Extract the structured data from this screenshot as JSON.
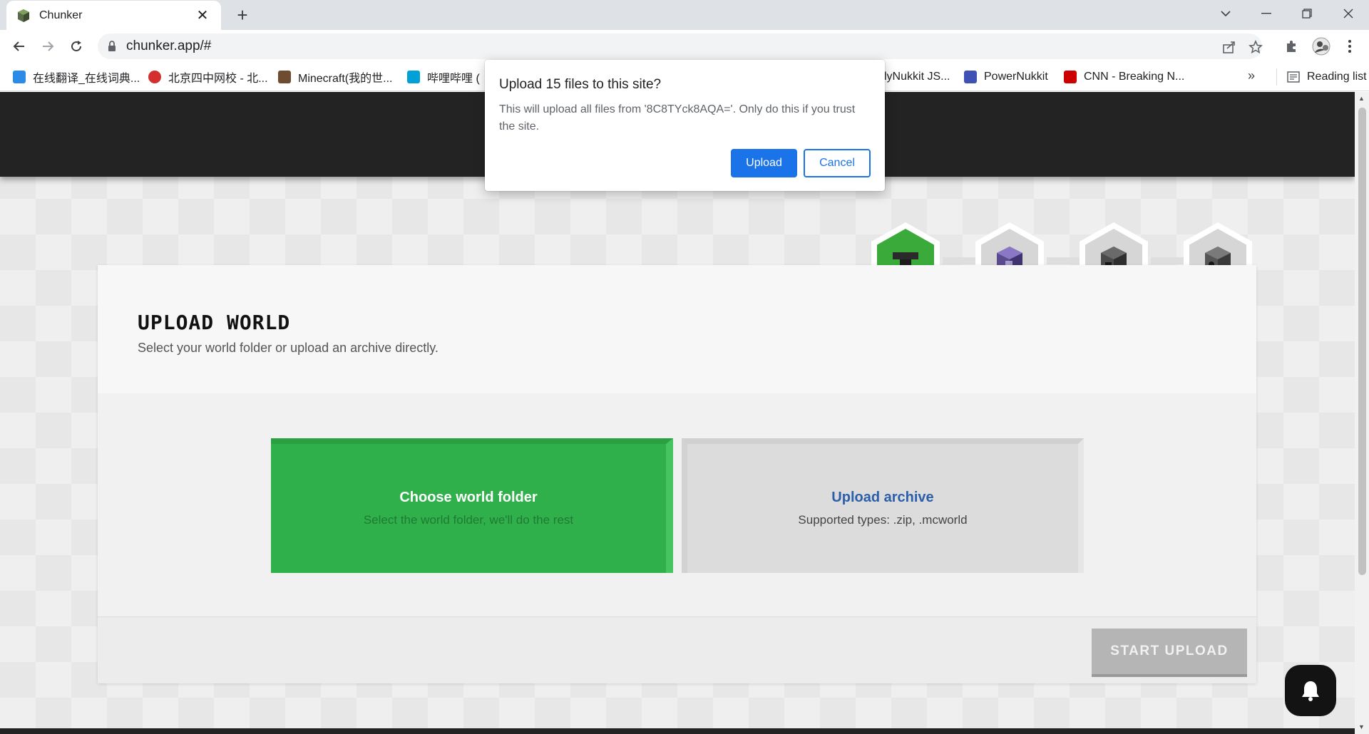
{
  "tab": {
    "title": "Chunker"
  },
  "toolbar": {
    "url": "chunker.app/#"
  },
  "bookmarks": [
    {
      "label": "在线翻译_在线词典...",
      "icon": "translate-icon",
      "color": "#2b8be6"
    },
    {
      "label": "北京四中网校 - 北...",
      "icon": "school-icon",
      "color": "#d32f2f"
    },
    {
      "label": "Minecraft(我的世...",
      "icon": "minecraft-icon",
      "color": "#6d4c2f"
    },
    {
      "label": "哔哩哔哩 (",
      "icon": "bilibili-icon",
      "color": "#00a1d6"
    },
    {
      "label": "lyNukkit JS...",
      "icon": "nukkit-icon",
      "color": "#4a4a4a"
    },
    {
      "label": "PowerNukkit",
      "icon": "powernukkit-icon",
      "color": "#3f51b5"
    },
    {
      "label": "CNN - Breaking N...",
      "icon": "cnn-icon",
      "color": "#cc0000"
    }
  ],
  "bookmarks_more": "»",
  "reading_list": "Reading list",
  "dialog": {
    "title": "Upload 15 files to this site?",
    "message": "This will upload all files from '8C8TYck8AQA='. Only do this if you trust the site.",
    "upload_label": "Upload",
    "cancel_label": "Cancel"
  },
  "card": {
    "title": "UPLOAD WORLD",
    "subtitle": "Select your world folder or upload an archive directly.",
    "option_folder": {
      "title": "Choose world folder",
      "desc": "Select the world folder, we'll do the rest"
    },
    "option_archive": {
      "title": "Upload archive",
      "desc": "Supported types: .zip, .mcworld"
    },
    "start_label": "START UPLOAD"
  },
  "steps": [
    {
      "icon": "anvil-icon",
      "active": true
    },
    {
      "icon": "command-block-icon",
      "active": false
    },
    {
      "icon": "furnace-icon",
      "active": false
    },
    {
      "icon": "dispenser-icon",
      "active": false
    }
  ],
  "colors": {
    "accent_green": "#30b04a",
    "dialog_blue": "#1a73e8",
    "archive_title": "#2b5faa"
  }
}
